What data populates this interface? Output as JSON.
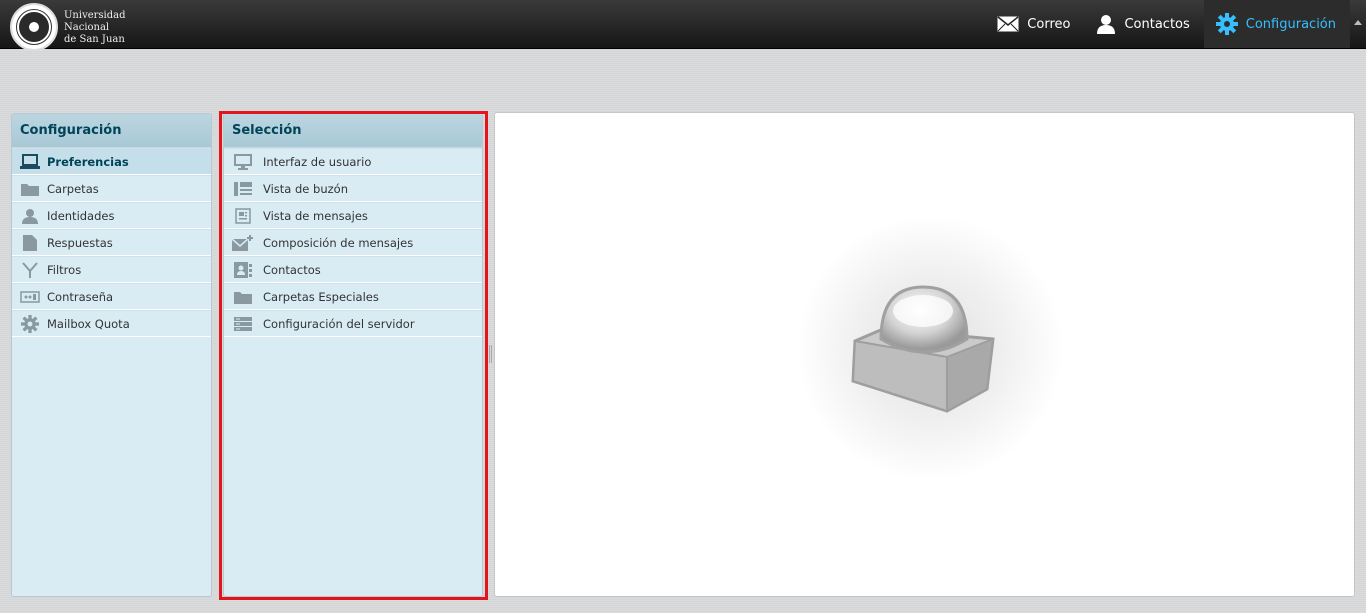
{
  "header": {
    "logo": {
      "line1": "Universidad",
      "line2": "Nacional",
      "line3": "de San Juan"
    },
    "nav": [
      {
        "label": "Correo",
        "icon": "envelope-icon"
      },
      {
        "label": "Contactos",
        "icon": "person-icon"
      },
      {
        "label": "Configuración",
        "icon": "gear-icon",
        "active": true
      }
    ]
  },
  "left_panel": {
    "title": "Configuración",
    "items": [
      {
        "label": "Preferencias",
        "icon": "laptop-icon",
        "selected": true
      },
      {
        "label": "Carpetas",
        "icon": "folder-icon"
      },
      {
        "label": "Identidades",
        "icon": "person-icon"
      },
      {
        "label": "Respuestas",
        "icon": "document-icon"
      },
      {
        "label": "Filtros",
        "icon": "filter-icon"
      },
      {
        "label": "Contraseña",
        "icon": "password-icon"
      },
      {
        "label": "Mailbox Quota",
        "icon": "gear-icon"
      }
    ]
  },
  "mid_panel": {
    "title": "Selección",
    "items": [
      {
        "label": "Interfaz de usuario",
        "icon": "monitor-icon"
      },
      {
        "label": "Vista de buzón",
        "icon": "mailbox-view-icon"
      },
      {
        "label": "Vista de mensajes",
        "icon": "message-view-icon"
      },
      {
        "label": "Composición de mensajes",
        "icon": "compose-icon"
      },
      {
        "label": "Contactos",
        "icon": "contact-card-icon"
      },
      {
        "label": "Carpetas Especiales",
        "icon": "folder-icon"
      },
      {
        "label": "Configuración del servidor",
        "icon": "server-icon"
      }
    ]
  },
  "colors": {
    "accent": "#37beff",
    "header_text": "#004458",
    "highlight_frame": "#e3141c"
  }
}
